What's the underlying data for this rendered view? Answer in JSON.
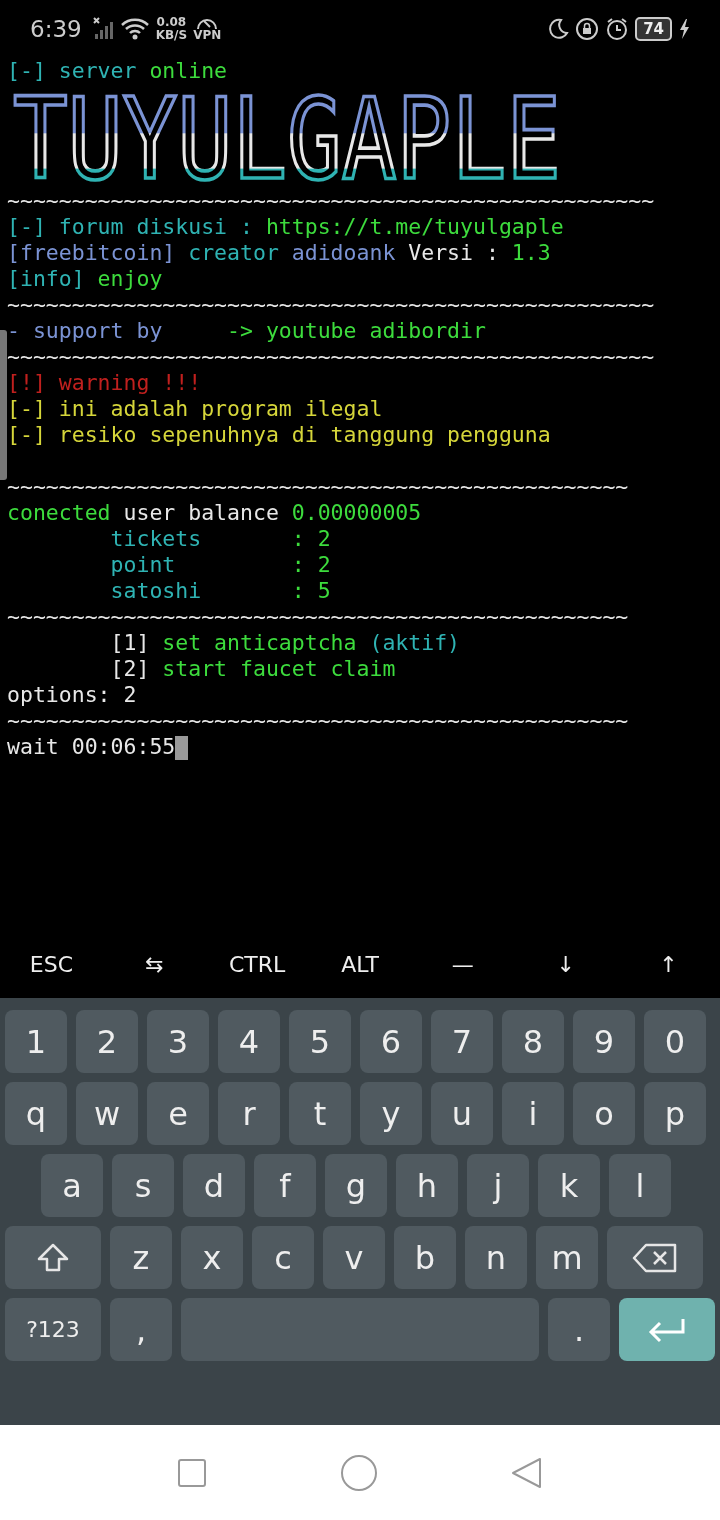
{
  "status_bar": {
    "time": "6:39",
    "speed_value": "0.08",
    "speed_unit": "KB/S",
    "vpn_label": "VPN",
    "battery": "74"
  },
  "terminal": {
    "lines": [
      {
        "kind": "text",
        "segments": [
          {
            "text": "[-] server ",
            "color": "#2fb3b3"
          },
          {
            "text": "online",
            "color": "#3ddc3d"
          }
        ]
      },
      {
        "kind": "banner",
        "text": "TUYULGAPLE"
      },
      {
        "kind": "text",
        "segments": [
          {
            "text": "~~~~~~~~~~~~~~~~~~~~~~~~~~~~~~~~~~~~~~~~~~~~~~~~~~",
            "color": "#e8e8e8"
          }
        ]
      },
      {
        "kind": "text",
        "segments": [
          {
            "text": "[-] forum diskusi : ",
            "color": "#2fb3b3"
          },
          {
            "text": "https://t.me/tuyulgaple",
            "color": "#3ddc3d"
          }
        ]
      },
      {
        "kind": "text",
        "segments": [
          {
            "text": "[freebitcoin] ",
            "color": "#7b93d4"
          },
          {
            "text": "creator ",
            "color": "#2fb3b3"
          },
          {
            "text": "adidoank ",
            "color": "#7b93d4"
          },
          {
            "text": "Versi : ",
            "color": "#e8e8e8"
          },
          {
            "text": "1.3",
            "color": "#3ddc3d"
          }
        ]
      },
      {
        "kind": "text",
        "segments": [
          {
            "text": "[info] ",
            "color": "#2fb3b3"
          },
          {
            "text": "enjoy",
            "color": "#3ddc3d"
          }
        ]
      },
      {
        "kind": "text",
        "segments": [
          {
            "text": "~~~~~~~~~~~~~~~~~~~~~~~~~~~~~~~~~~~~~~~~~~~~~~~~~~",
            "color": "#e8e8e8"
          }
        ]
      },
      {
        "kind": "text",
        "segments": [
          {
            "text": "- support by     ",
            "color": "#7b93d4"
          },
          {
            "text": "-> youtube adibordir",
            "color": "#3ddc3d"
          }
        ]
      },
      {
        "kind": "text",
        "segments": [
          {
            "text": "~~~~~~~~~~~~~~~~~~~~~~~~~~~~~~~~~~~~~~~~~~~~~~~~~~",
            "color": "#e8e8e8"
          }
        ]
      },
      {
        "kind": "text",
        "segments": [
          {
            "text": "[!] warning !!!",
            "color": "#c0201e"
          }
        ]
      },
      {
        "kind": "text",
        "segments": [
          {
            "text": "[-] ini adalah program ilegal",
            "color": "#d6d63a"
          }
        ]
      },
      {
        "kind": "text",
        "segments": [
          {
            "text": "[-] resiko sepenuhnya di tanggung pengguna",
            "color": "#d6d63a"
          }
        ]
      },
      {
        "kind": "blank"
      },
      {
        "kind": "text",
        "segments": [
          {
            "text": "~~~~~~~~~~~~~~~~~~~~~~~~~~~~~~~~~~~~~~~~~~~~~~~~",
            "color": "#e8e8e8"
          }
        ]
      },
      {
        "kind": "text",
        "segments": [
          {
            "text": "conected ",
            "color": "#3ddc3d"
          },
          {
            "text": "user balance ",
            "color": "#e8e8e8"
          },
          {
            "text": "0.00000005",
            "color": "#3ddc3d"
          }
        ]
      },
      {
        "kind": "text",
        "segments": [
          {
            "text": "        tickets       ",
            "color": "#2fb3b3"
          },
          {
            "text": ": 2",
            "color": "#3ddc3d"
          }
        ]
      },
      {
        "kind": "text",
        "segments": [
          {
            "text": "        point         ",
            "color": "#2fb3b3"
          },
          {
            "text": ": 2",
            "color": "#3ddc3d"
          }
        ]
      },
      {
        "kind": "text",
        "segments": [
          {
            "text": "        satoshi       ",
            "color": "#2fb3b3"
          },
          {
            "text": ": 5",
            "color": "#3ddc3d"
          }
        ]
      },
      {
        "kind": "text",
        "segments": [
          {
            "text": "~~~~~~~~~~~~~~~~~~~~~~~~~~~~~~~~~~~~~~~~~~~~~~~~",
            "color": "#e8e8e8"
          }
        ]
      },
      {
        "kind": "text",
        "segments": [
          {
            "text": "        [1] ",
            "color": "#e8e8e8"
          },
          {
            "text": "set anticaptcha ",
            "color": "#3ddc3d"
          },
          {
            "text": "(aktif)",
            "color": "#2fb3b3"
          }
        ]
      },
      {
        "kind": "text",
        "segments": [
          {
            "text": "        [2] ",
            "color": "#e8e8e8"
          },
          {
            "text": "start faucet claim",
            "color": "#3ddc3d"
          }
        ]
      },
      {
        "kind": "text",
        "segments": [
          {
            "text": "options: 2",
            "color": "#e8e8e8"
          }
        ]
      },
      {
        "kind": "text",
        "segments": [
          {
            "text": "~~~~~~~~~~~~~~~~~~~~~~~~~~~~~~~~~~~~~~~~~~~~~~~~",
            "color": "#e8e8e8"
          }
        ]
      },
      {
        "kind": "prompt",
        "segments": [
          {
            "text": "wait 00:06:55",
            "color": "#e8e8e8"
          }
        ]
      }
    ]
  },
  "extra_keys": [
    "ESC",
    "⇆",
    "CTRL",
    "ALT",
    "—",
    "↓",
    "↑"
  ],
  "keyboard": {
    "rows": [
      [
        {
          "kind": "char",
          "label": "1"
        },
        {
          "kind": "char",
          "label": "2"
        },
        {
          "kind": "char",
          "label": "3"
        },
        {
          "kind": "char",
          "label": "4"
        },
        {
          "kind": "char",
          "label": "5"
        },
        {
          "kind": "char",
          "label": "6"
        },
        {
          "kind": "char",
          "label": "7"
        },
        {
          "kind": "char",
          "label": "8"
        },
        {
          "kind": "char",
          "label": "9"
        },
        {
          "kind": "char",
          "label": "0"
        }
      ],
      [
        {
          "kind": "char",
          "label": "q"
        },
        {
          "kind": "char",
          "label": "w"
        },
        {
          "kind": "char",
          "label": "e"
        },
        {
          "kind": "char",
          "label": "r"
        },
        {
          "kind": "char",
          "label": "t"
        },
        {
          "kind": "char",
          "label": "y"
        },
        {
          "kind": "char",
          "label": "u"
        },
        {
          "kind": "char",
          "label": "i"
        },
        {
          "kind": "char",
          "label": "o"
        },
        {
          "kind": "char",
          "label": "p"
        }
      ],
      [
        {
          "kind": "char",
          "label": "a"
        },
        {
          "kind": "char",
          "label": "s"
        },
        {
          "kind": "char",
          "label": "d"
        },
        {
          "kind": "char",
          "label": "f"
        },
        {
          "kind": "char",
          "label": "g"
        },
        {
          "kind": "char",
          "label": "h"
        },
        {
          "kind": "char",
          "label": "j"
        },
        {
          "kind": "char",
          "label": "k"
        },
        {
          "kind": "char",
          "label": "l"
        }
      ],
      [
        {
          "kind": "shift"
        },
        {
          "kind": "char",
          "label": "z"
        },
        {
          "kind": "char",
          "label": "x"
        },
        {
          "kind": "char",
          "label": "c"
        },
        {
          "kind": "char",
          "label": "v"
        },
        {
          "kind": "char",
          "label": "b"
        },
        {
          "kind": "char",
          "label": "n"
        },
        {
          "kind": "char",
          "label": "m"
        },
        {
          "kind": "backspace"
        }
      ],
      [
        {
          "kind": "mode",
          "label": "?123"
        },
        {
          "kind": "char",
          "label": ","
        },
        {
          "kind": "space"
        },
        {
          "kind": "char",
          "label": "."
        },
        {
          "kind": "enter"
        }
      ]
    ]
  }
}
